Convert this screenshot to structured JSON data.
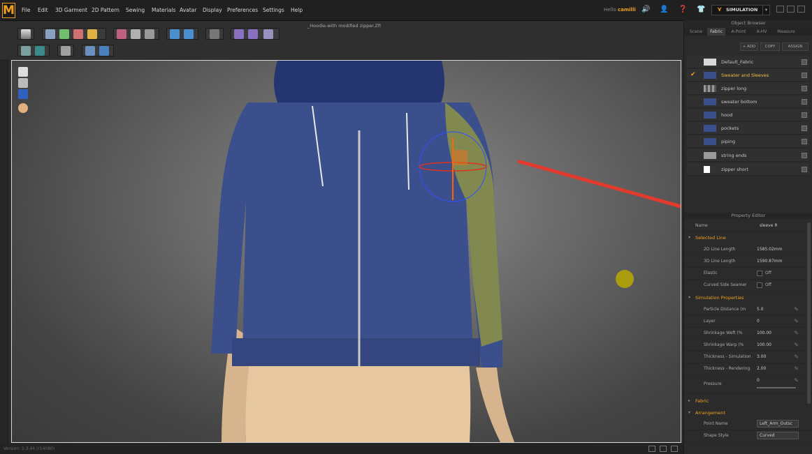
{
  "app": {
    "logo": "M",
    "document_title": "_Hoodie-with modified zipper.Zfi",
    "user_greeting": "Hello",
    "user_name": "camilli",
    "mode_button": "SIMULATION",
    "version": "Version: 2.3.44    (r14080)"
  },
  "menu": [
    "File",
    "Edit",
    "3D Garment",
    "2D Pattern",
    "Sewing",
    "Materials",
    "Avatar",
    "Display",
    "Preferences",
    "Settings",
    "Help"
  ],
  "object_browser": {
    "title": "Object Browser",
    "tabs": [
      "Scene",
      "Fabric",
      "A-Point",
      "A-HV",
      "Measure"
    ],
    "active_tab": "Fabric",
    "buttons": {
      "add": "+ ADD",
      "copy": "COPY",
      "assign": "ASSIGN"
    },
    "items": [
      {
        "name": "Default_Fabric",
        "color": "#d8d8d8",
        "selected": false
      },
      {
        "name": "Sweater and Sleeves",
        "color": "#3b4f8c",
        "selected": true
      },
      {
        "name": "zipper long",
        "color": "#8a8a8a",
        "selected": false
      },
      {
        "name": "sweater bottom",
        "color": "#3b4f8c",
        "selected": false
      },
      {
        "name": "hood",
        "color": "#3b4f8c",
        "selected": false
      },
      {
        "name": "pockets",
        "color": "#3b4f8c",
        "selected": false
      },
      {
        "name": "piping",
        "color": "#3b4f8c",
        "selected": false
      },
      {
        "name": "string ends",
        "color": "#9a9a9a",
        "selected": false
      },
      {
        "name": "zipper short",
        "color": "#777777",
        "selected": false
      }
    ]
  },
  "property_editor": {
    "title": "Property Editor",
    "name_label": "Name",
    "name_value": "sleeve R",
    "selected_line": {
      "header": "Selected Line",
      "rows": [
        {
          "label": "2D Line Length",
          "value": "1585.02mm"
        },
        {
          "label": "3D Line Length",
          "value": "1590.87mm"
        },
        {
          "label": "Elastic",
          "value": "Off"
        },
        {
          "label": "Curved Side Seamer",
          "value": "Off"
        }
      ]
    },
    "simulation": {
      "header": "Simulation Properties",
      "rows": [
        {
          "label": "Particle Distance (m",
          "value": "5.0"
        },
        {
          "label": "Layer",
          "value": "0"
        },
        {
          "label": "Shrinkage Weft (%",
          "value": "100.00"
        },
        {
          "label": "Shrinkage Warp (%",
          "value": "100.00"
        },
        {
          "label": "Thickness - Simulation",
          "value": "3.00"
        },
        {
          "label": "Thickness - Rendering",
          "value": "2.00"
        }
      ],
      "pressure_label": "Pressure",
      "pressure_value": "0"
    },
    "fabric_header": "Fabric",
    "arrangement": {
      "header": "Arrangement",
      "rows": [
        {
          "label": "Point Name",
          "value": "Left_Arm_Outsc"
        },
        {
          "label": "Shape Style",
          "value": "Curved"
        }
      ]
    }
  },
  "colors": {
    "accent": "#f0a020",
    "hoodie": "#3b4f8c",
    "arrow": "#e23b2e",
    "highlight": "#9aa04a"
  }
}
